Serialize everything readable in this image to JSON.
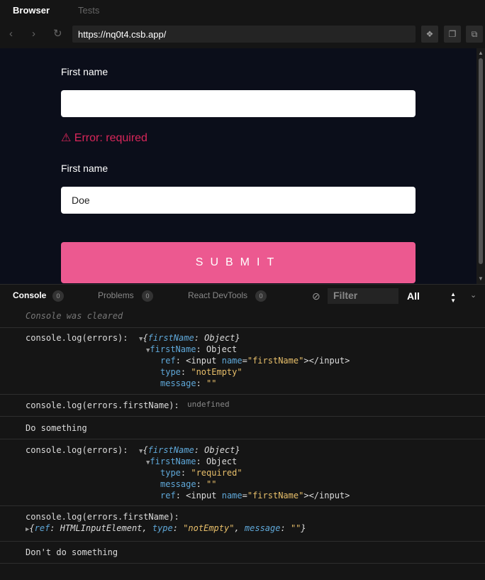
{
  "tabs": {
    "browser": "Browser",
    "tests": "Tests"
  },
  "nav": {
    "url": "https://nq0t4.csb.app/"
  },
  "form": {
    "label1": "First name",
    "input1_value": "",
    "error_icon": "⚠",
    "error_text": "Error: required",
    "label2": "First name",
    "input2_value": "Doe",
    "submit": "SUBMIT"
  },
  "console_header": {
    "console": "Console",
    "console_count": "0",
    "problems": "Problems",
    "problems_count": "0",
    "devtools": "React DevTools",
    "devtools_count": "0",
    "filter_placeholder": "Filter",
    "level": "All"
  },
  "console": {
    "cleared": "Console was cleared",
    "e1": {
      "call": "console.log(errors):",
      "obj": "{",
      "key": "firstName",
      "rest": ": Object}",
      "sub_key": "firstName",
      "sub_val": ": Object",
      "ref_key": "ref",
      "ref_a": ": <input ",
      "ref_attr": "name",
      "ref_eq": "=",
      "ref_val": "\"firstName\"",
      "ref_end": "></input>",
      "type_key": "type",
      "type_val": "\"notEmpty\"",
      "msg_key": "message",
      "msg_val": "\"\""
    },
    "e2": {
      "call": "console.log(errors.firstName):",
      "val": "undefined"
    },
    "e3": {
      "text": "Do something"
    },
    "e4": {
      "call": "console.log(errors):",
      "type_val": "\"required\"",
      "msg_val": "\"\""
    },
    "e5": {
      "call": "console.log(errors.firstName):",
      "ref": "ref",
      "ref_val": "HTMLInputElement",
      "type": "type",
      "type_val": "\"notEmpty\"",
      "msg": "message",
      "msg_val": "\"\""
    },
    "e6": {
      "text": "Don't do something"
    }
  }
}
